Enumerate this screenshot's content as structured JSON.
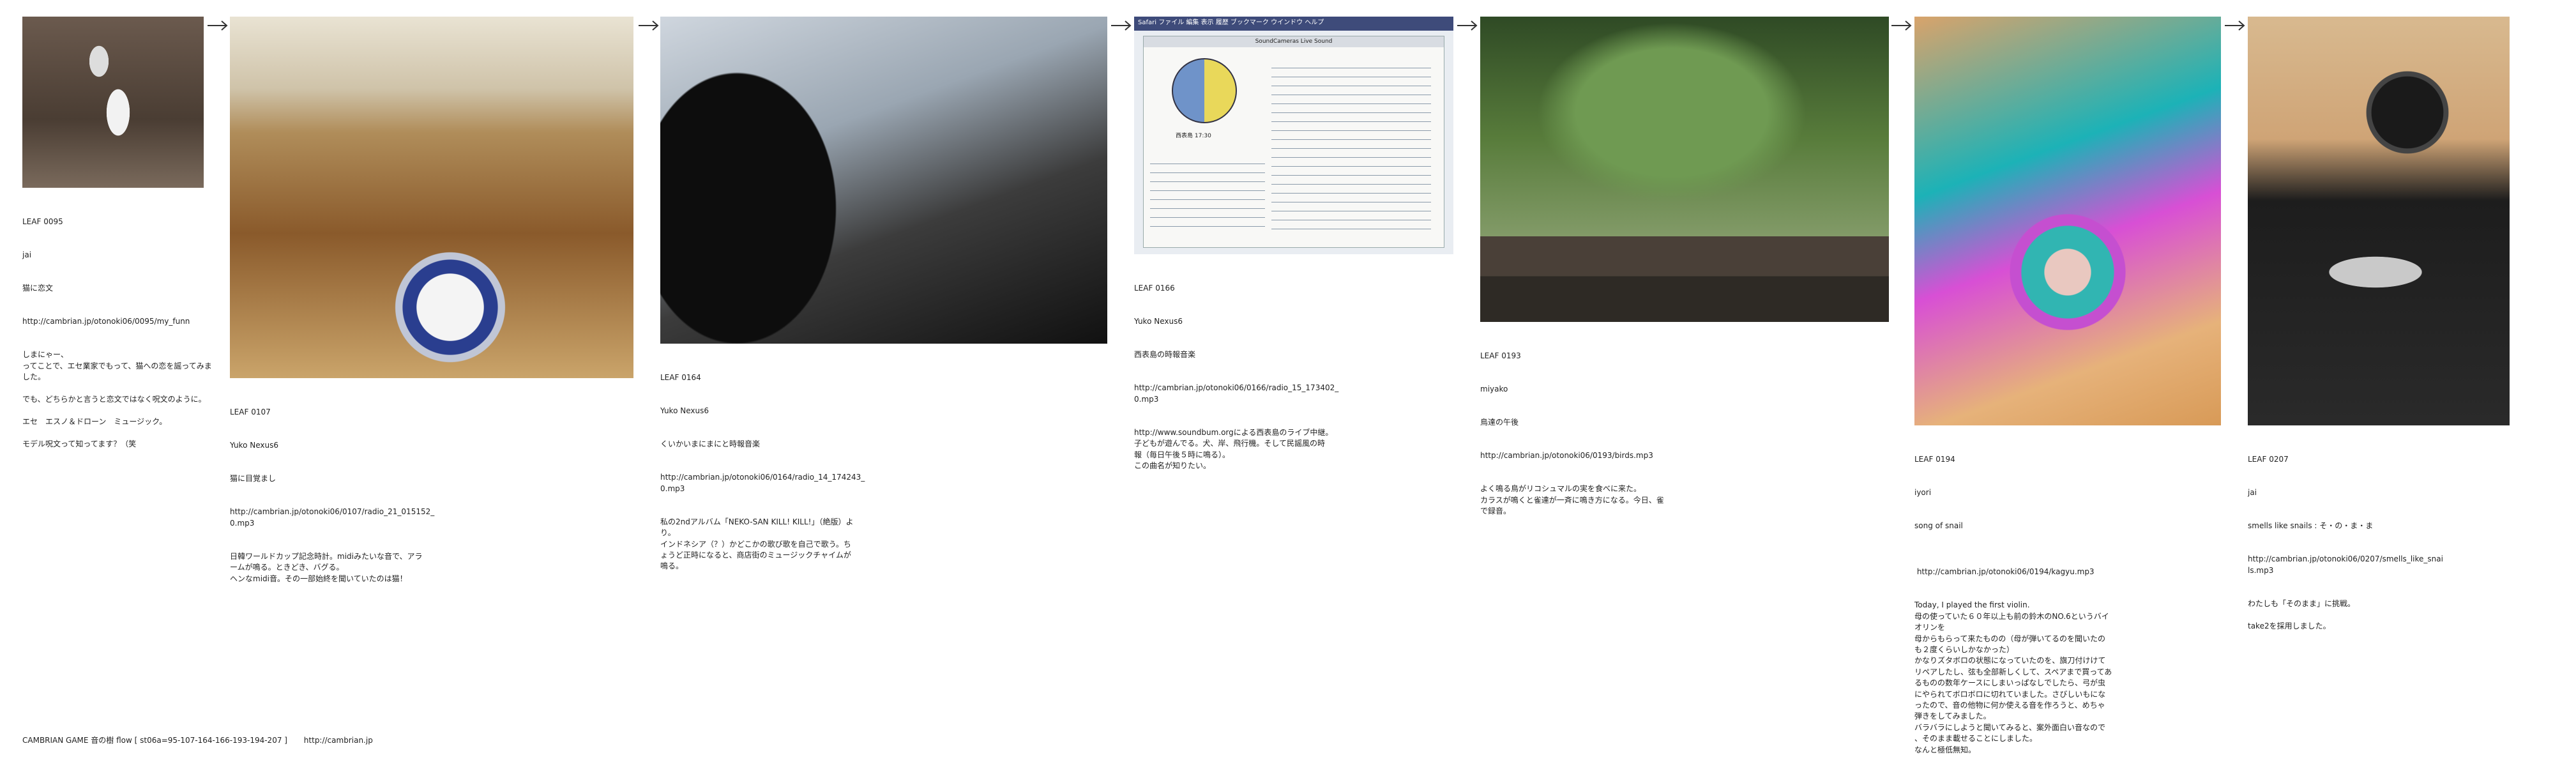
{
  "leaves": [
    {
      "id": "LEAF 0095",
      "author": "jai",
      "title": "猫に恋文",
      "url": "http://cambrian.jp/otonoki06/0095/my_funn",
      "body": "しまにゃー、\nってことで、エセ業家でもって、猫への恋を謡ってみま\nした。\n\nでも、どちらかと言うと恋文ではなく呪文のように。\n\nエセ　エスノ＆ドローン　ミュージック。\n\nモデル呪文って知ってます？（笑"
    },
    {
      "id": "LEAF 0107",
      "author": "Yuko Nexus6",
      "title": "猫に目覚まし",
      "url": "http://cambrian.jp/otonoki06/0107/radio_21_015152_\n0.mp3",
      "body": "日韓ワールドカップ記念時計。midiみたいな音で、アラ\nームが鳴る。ときどき、バグる。\nヘンなmidi音。その一部始終を聞いていたのは猫！"
    },
    {
      "id": "LEAF 0164",
      "author": "Yuko Nexus6",
      "title": "くいかいまにまにと時報音楽",
      "url": "http://cambrian.jp/otonoki06/0164/radio_14_174243_\n0.mp3",
      "body": "私の2ndアルバム「NEKO-SAN KILL! KILL!」（絶版）よ\nり。\nインドネシア（？）かどこかの歌び歌を自己で歌う。ち\nょうど正時になると、商店街のミュージックチャイムが\n鳴る。"
    },
    {
      "id": "LEAF 0166",
      "author": "Yuko Nexus6",
      "title": "西表島の時報音楽",
      "url": "http://cambrian.jp/otonoki06/0166/radio_15_173402_\n0.mp3",
      "body": "http://www.soundbum.orgによる西表島のライブ中継。\n子どもが遊んでる。犬、岸、飛行機。そして民謡風の時\n報（毎日午後５時に鳴る）。\nこの曲名が知りたい。"
    },
    {
      "id": "LEAF 0193",
      "author": "miyako",
      "title": "鳥達の午後",
      "url": "http://cambrian.jp/otonoki06/0193/birds.mp3",
      "body": "よく鳴る鳥がリコシュマルの実を食べに来た。\nカラスが鳴くと雀達が一斉に鳴き方になる。今日、雀\nで録音。"
    },
    {
      "id": "LEAF 0194",
      "author": "iyori",
      "title": "song of snail",
      "url": " http://cambrian.jp/otonoki06/0194/kagyu.mp3",
      "body": "Today, I played the first violin.\n母の使っていた６０年以上も前の鈴木のNO.6というバイ\nオリンを\n母からもらって来たものの（母が弾いてるのを聞いたの\nも２度くらいしかなかった）\nかなりズタボロの状態になっていたのを、旗刀付けけて\nリペアしたし、弦も全部新しくして、スペアまで買ってあ\nるものの数年ケースにしまいっぱなしでしたら、弓が虫\nにやられてボロボロに切れていました。さびしいもにな\nったので、音の他物に何か使える音を作ろうと、めちゃ\n弾きをしてみました。\nバラバラにしようと聞いてみると、案外面白い音なので\n、そのまま載せることにしました。\nなんと極低無知。"
    },
    {
      "id": "LEAF 0207",
      "author": "jai",
      "title": "smells like snails : そ・の・ま・ま",
      "url": "http://cambrian.jp/otonoki06/0207/smells_like_snai\nls.mp3",
      "body": "わたしも「そのまま」に挑戦。\n\ntake2を採用しました。"
    }
  ],
  "footer": {
    "label": "CAMBRIAN GAME 音の樹 flow [ st06a=95-107-164-166-193-194-207 ]",
    "url": "http://cambrian.jp"
  },
  "photos": {
    "p1": "cat-photo",
    "p2": "alarm-clock-photo",
    "p3": "dusk-sky-photo",
    "p4": "desktop-screenshot",
    "p5": "garden-photo",
    "p6": "painted-spiral",
    "p7": "violin-scroll-photo"
  },
  "screenshot_app": {
    "menu": "Safari  ファイル  編集  表示  履歴  ブックマーク  ウインドウ  ヘルプ",
    "window_title": "SoundCameras Live Sound",
    "clock_caption": "西表島  17:30"
  }
}
